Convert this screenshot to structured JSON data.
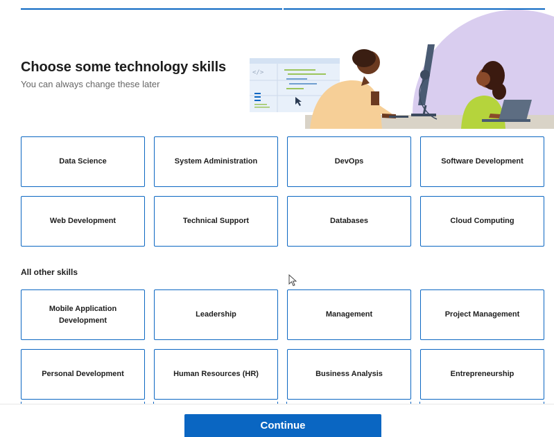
{
  "header": {
    "title": "Choose some technology skills",
    "subtitle": "You can always change these later",
    "illustration_code_tag": "</>"
  },
  "featured_skills": [
    "Data Science",
    "System Administration",
    "DevOps",
    "Software Development",
    "Web Development",
    "Technical Support",
    "Databases",
    "Cloud Computing"
  ],
  "other_section": {
    "label": "All other skills",
    "skills": [
      "Mobile Application Development",
      "Leadership",
      "Management",
      "Project Management",
      "Personal Development",
      "Human Resources (HR)",
      "Business Analysis",
      "Entrepreneurship"
    ]
  },
  "footer": {
    "continue_label": "Continue"
  },
  "colors": {
    "accent": "#0a66c2",
    "illustration_lavender": "#d9cdef"
  }
}
